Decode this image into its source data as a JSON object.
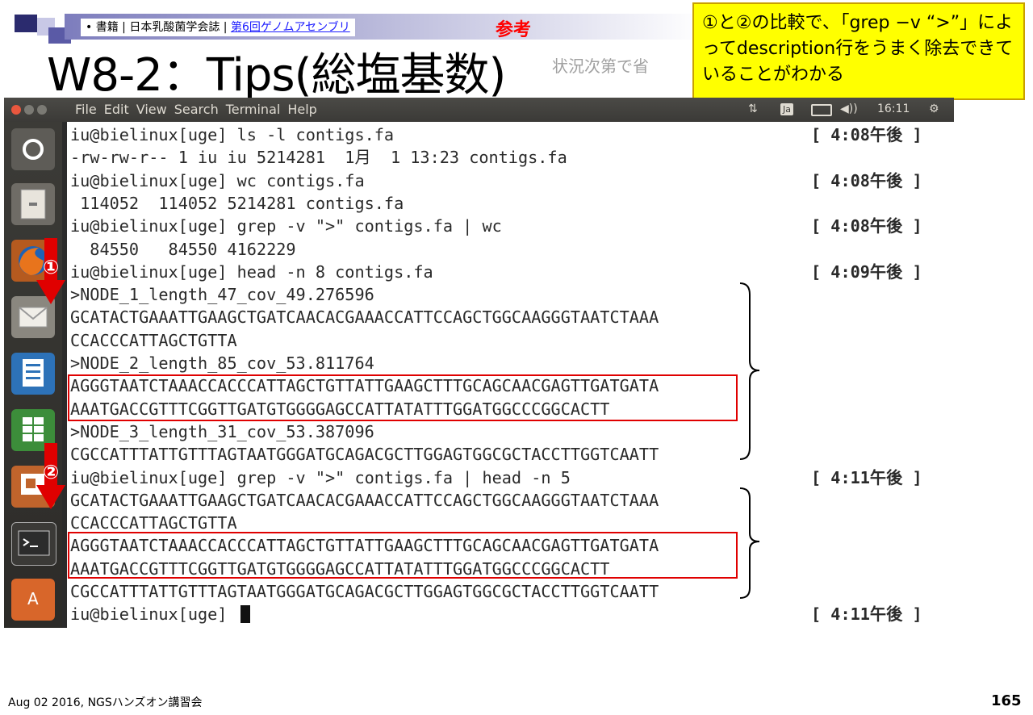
{
  "slide": {
    "breadcrumb_prefix": "• 書籍 | 日本乳酸菌学会誌 | ",
    "breadcrumb_link": "第6回ゲノムアセンブリ",
    "reference_tag": "参考",
    "title": "W8-2：Tips(総塩基数)",
    "subnote": "状況次第で省",
    "callout": "①と②の比較で､「grep −v “>”」によってdescription行をうまく除去できていることがわかる",
    "marker_1": "①",
    "marker_2": "②",
    "footer": "Aug 02 2016, NGSハンズオン講習会",
    "page_number": "165"
  },
  "menubar": {
    "items": [
      "File",
      "Edit",
      "View",
      "Search",
      "Terminal",
      "Help"
    ],
    "input_method": "Ja",
    "volume": "◀))",
    "clock": "16:11",
    "power": "⚙"
  },
  "terminal": {
    "lines": [
      {
        "text": "iu@bielinux[uge] ls -l contigs.fa",
        "ts": "[ 4:08午後 ]"
      },
      {
        "text": "-rw-rw-r-- 1 iu iu 5214281  1月  1 13:23 contigs.fa",
        "ts": ""
      },
      {
        "text": "iu@bielinux[uge] wc contigs.fa",
        "ts": "[ 4:08午後 ]"
      },
      {
        "text": " 114052  114052 5214281 contigs.fa",
        "ts": ""
      },
      {
        "text": "iu@bielinux[uge] grep -v \">\" contigs.fa | wc",
        "ts": "[ 4:08午後 ]"
      },
      {
        "text": "  84550   84550 4162229",
        "ts": ""
      },
      {
        "text": "iu@bielinux[uge] head -n 8 contigs.fa",
        "ts": "[ 4:09午後 ]"
      },
      {
        "text": ">NODE_1_length_47_cov_49.276596",
        "ts": ""
      },
      {
        "text": "GCATACTGAAATTGAAGCTGATCAACACGAAACCATTCCAGCTGGCAAGGGTAATCTAAA",
        "ts": ""
      },
      {
        "text": "CCACCCATTAGCTGTTA",
        "ts": ""
      },
      {
        "text": ">NODE_2_length_85_cov_53.811764",
        "ts": ""
      },
      {
        "text": "AGGGTAATCTAAACCACCCATTAGCTGTTATTGAAGCTTTGCAGCAACGAGTTGATGATA",
        "ts": ""
      },
      {
        "text": "AAATGACCGTTTCGGTTGATGTGGGGAGCCATTATATTTGGATGGCCCGGCACTT",
        "ts": ""
      },
      {
        "text": ">NODE_3_length_31_cov_53.387096",
        "ts": ""
      },
      {
        "text": "CGCCATTTATTGTTTAGTAATGGGATGCAGACGCTTGGAGTGGCGCTACCTTGGTCAATT",
        "ts": ""
      },
      {
        "text": "iu@bielinux[uge] grep -v \">\" contigs.fa | head -n 5",
        "ts": "[ 4:11午後 ]"
      },
      {
        "text": "GCATACTGAAATTGAAGCTGATCAACACGAAACCATTCCAGCTGGCAAGGGTAATCTAAA",
        "ts": ""
      },
      {
        "text": "CCACCCATTAGCTGTTA",
        "ts": ""
      },
      {
        "text": "AGGGTAATCTAAACCACCCATTAGCTGTTATTGAAGCTTTGCAGCAACGAGTTGATGATA",
        "ts": ""
      },
      {
        "text": "AAATGACCGTTTCGGTTGATGTGGGGAGCCATTATATTTGGATGGCCCGGCACTT",
        "ts": ""
      },
      {
        "text": "CGCCATTTATTGTTTAGTAATGGGATGCAGACGCTTGGAGTGGCGCTACCTTGGTCAATT",
        "ts": ""
      },
      {
        "text": "iu@bielinux[uge] ",
        "ts": "[ 4:11午後 ]"
      }
    ]
  },
  "launcher_icons": [
    "ubuntu-dash-icon",
    "file-cabinet-icon",
    "firefox-icon",
    "mail-icon",
    "writer-doc-icon",
    "calc-spreadsheet-icon",
    "impress-presentation-icon",
    "terminal-icon",
    "software-center-icon"
  ],
  "colors": {
    "highlight_red": "#e00000",
    "callout_yellow": "#ffff00",
    "accent_arrow": "#e00000"
  }
}
